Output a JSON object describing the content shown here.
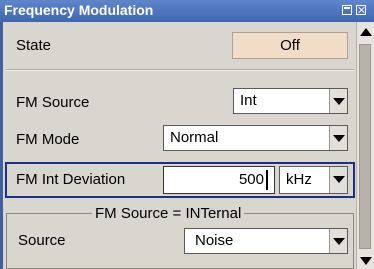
{
  "window": {
    "title": "Frequency Modulation"
  },
  "state": {
    "label": "State",
    "button": "Off"
  },
  "fm_source": {
    "label": "FM Source",
    "value": "Int"
  },
  "fm_mode": {
    "label": "FM Mode",
    "value": "Normal"
  },
  "fm_int_deviation": {
    "label": "FM Int Deviation",
    "value": "500",
    "unit": "kHz"
  },
  "internal_group": {
    "title": "FM Source = INTernal",
    "source_label": "Source",
    "source_value": "Noise"
  }
}
